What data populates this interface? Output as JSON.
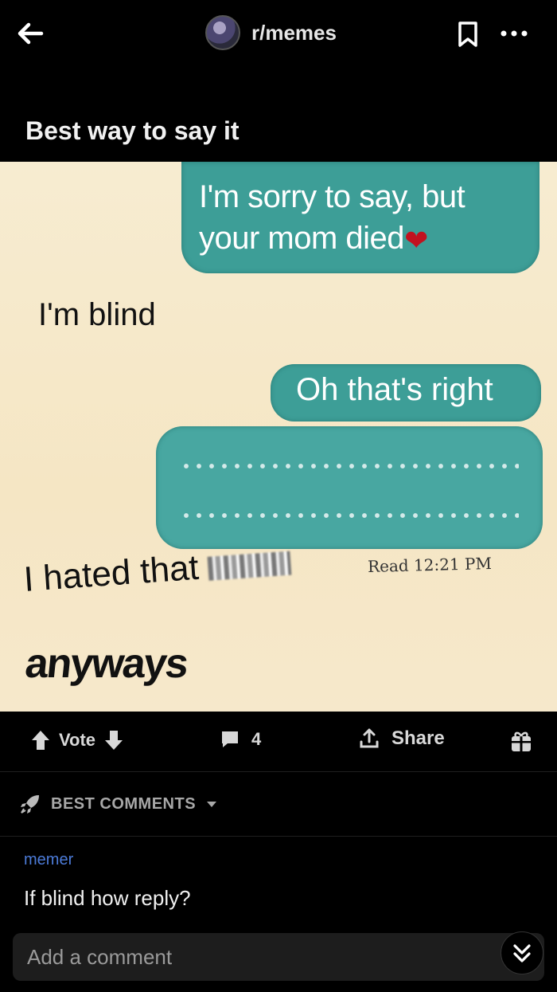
{
  "header": {
    "subreddit": "r/memes",
    "back_icon": "back-arrow-icon",
    "save_icon": "bookmark-icon",
    "more_icon": "more-dots-icon"
  },
  "post": {
    "title": "Best way to say it"
  },
  "meme": {
    "bubble1_line1": "I'm sorry to say, but",
    "bubble1_line2": "your mom died",
    "reply1": "I'm blind",
    "bubble2": "Oh that's right",
    "read_receipt": "Read 12:21 PM",
    "reply2_prefix": "I hated that",
    "reply2_last": "anyways",
    "bubble_color": "#3d9e97"
  },
  "actions": {
    "vote_label": "Vote",
    "comments_count": "4",
    "share_label": "Share"
  },
  "comments": {
    "sort_label": "BEST COMMENTS",
    "first_meta_flair": "memer",
    "first_text": "If blind how reply?"
  },
  "composer": {
    "placeholder": "Add a comment"
  }
}
